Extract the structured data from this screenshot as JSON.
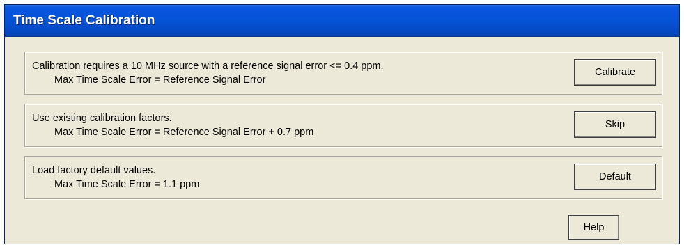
{
  "window": {
    "title": "Time Scale Calibration"
  },
  "options": [
    {
      "description": "Calibration requires a 10 MHz source with a reference signal error <= 0.4 ppm.",
      "detail": "Max Time Scale Error = Reference Signal Error",
      "button_label": "Calibrate"
    },
    {
      "description": "Use existing calibration factors.",
      "detail": "Max Time Scale Error = Reference Signal Error + 0.7 ppm",
      "button_label": "Skip"
    },
    {
      "description": "Load factory default values.",
      "detail": "Max Time Scale Error = 1.1 ppm",
      "button_label": "Default"
    }
  ],
  "help_label": "Help"
}
